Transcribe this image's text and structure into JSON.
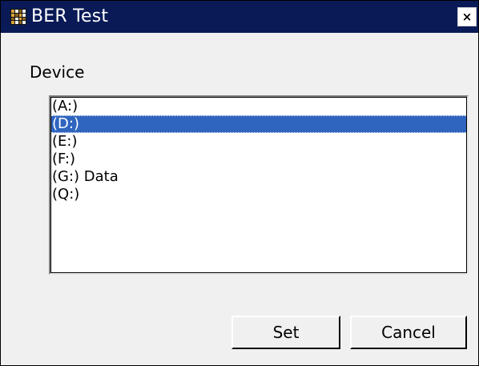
{
  "window": {
    "title": "BER Test",
    "close_glyph": "×"
  },
  "device": {
    "label": "Device",
    "items": [
      {
        "label": "(A:)"
      },
      {
        "label": "(D:)"
      },
      {
        "label": "(E:)"
      },
      {
        "label": "(F:)"
      },
      {
        "label": "(G:) Data"
      },
      {
        "label": "(Q:)"
      }
    ],
    "selected_index": 1
  },
  "buttons": {
    "set_label": "Set",
    "cancel_label": "Cancel"
  },
  "colors": {
    "titlebar": "#0a1a57",
    "selection": "#2f65bf",
    "dialog_background": "#f0f0f0"
  },
  "icons": {
    "app": "app-icon",
    "close": "close-icon"
  }
}
